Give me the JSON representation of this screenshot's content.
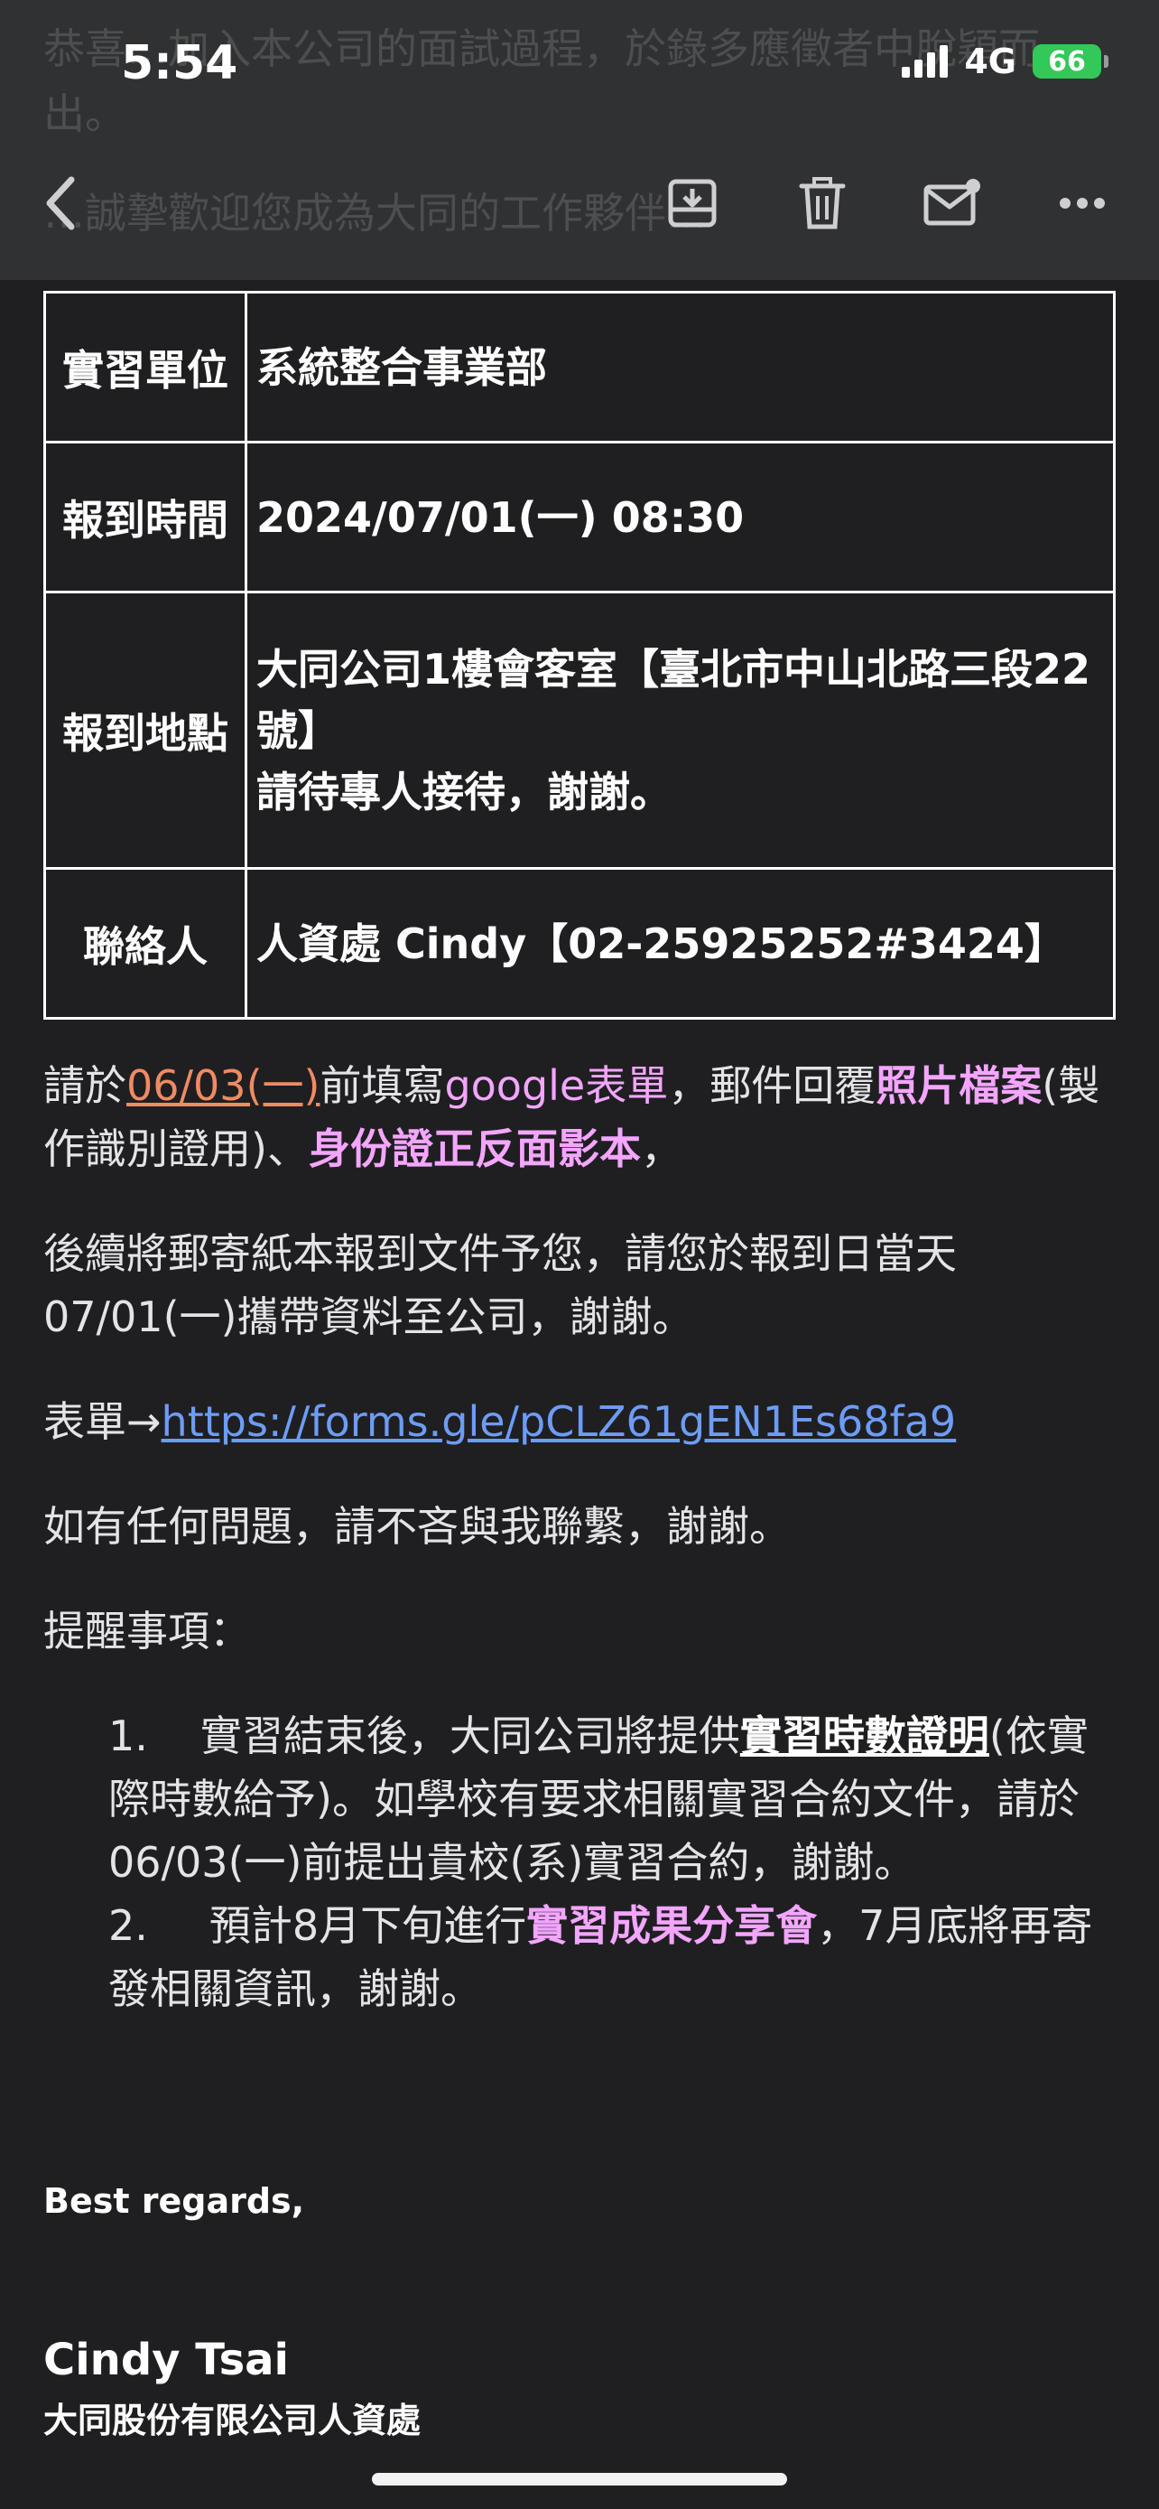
{
  "status_bar": {
    "time": "5:54",
    "network": "4G",
    "battery": "66"
  },
  "ghost_header": {
    "line1": "恭喜…加入本公司的面試過程，於錄多應徵者中脫穎而",
    "line2": "出。",
    "line3": "…誠摯歡迎您成為大同的工作夥伴…"
  },
  "toolbar": {
    "back": "back-icon",
    "archive": "archive-icon",
    "trash": "trash-icon",
    "mark_unread": "mark-unread-icon",
    "more": "more-icon"
  },
  "info_table": [
    {
      "key": "實習單位",
      "value": "系統整合事業部"
    },
    {
      "key": "報到時間",
      "value": "2024/07/01(一) 08:30"
    },
    {
      "key": "報到地點",
      "value": "大同公司1樓會客室【臺北市中山北路三段22號】",
      "value2": "請待專人接待，謝謝。"
    },
    {
      "key": "聯絡人",
      "value": "人資處 Cindy【02-25925252#3424】"
    }
  ],
  "para1": {
    "t1": "請於",
    "date": "06/03(一)",
    "t2": "前填寫",
    "form": "google表單",
    "t3": "，郵件回覆",
    "photo": "照片檔案",
    "t4": "(製作識別證用)、",
    "id": "身份證正反面影本",
    "t5": "，"
  },
  "para2": {
    "line1": "後續將郵寄紙本報到文件予您，請您於報到日當天",
    "line2": "07/01(一)攜帶資料至公司，謝謝。"
  },
  "form_line": {
    "label": "表單→",
    "url": "https://forms.gle/pCLZ61gEN1Es68fa9"
  },
  "para3": "如有任何問題，請不吝與我聯繫，謝謝。",
  "reminder_title": "提醒事項：",
  "reminders": [
    {
      "num": "1.",
      "a": "實習結束後，大同公司將提供",
      "hl": "實習時數證明",
      "b": "(依實際時數給予)。如學校有要求相關實習合約文件，請於06/03(一)前提出貴校(系)實習合約，謝謝。"
    },
    {
      "num": "2.",
      "a": "預計8月下旬進行",
      "hl": "實習成果分享會",
      "b": "，7月底將再寄發相關資訊，謝謝。"
    }
  ],
  "signoff": "Best regards,",
  "signature": {
    "name": "Cindy Tsai",
    "org": "大同股份有限公司人資處"
  }
}
